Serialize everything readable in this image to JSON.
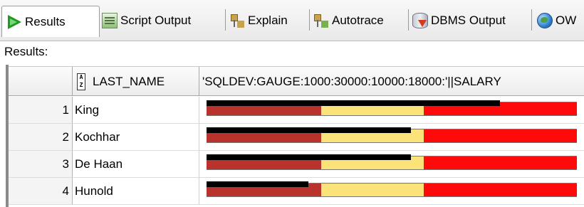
{
  "tabs": [
    {
      "label": "Results",
      "icon": "play-icon"
    },
    {
      "label": "Script Output",
      "icon": "script-output-icon"
    },
    {
      "label": "Explain",
      "icon": "explain-icon"
    },
    {
      "label": "Autotrace",
      "icon": "autotrace-icon"
    },
    {
      "label": "DBMS Output",
      "icon": "dbms-output-icon"
    },
    {
      "label": "OW",
      "icon": "globe-icon"
    }
  ],
  "results_label": "Results:",
  "columns": {
    "last_name": "LAST_NAME",
    "gauge": "'SQLDEV:GAUGE:1000:30000:10000:18000:'||SALARY"
  },
  "gauge_spec": {
    "min": 1000,
    "max": 30000,
    "low": 10000,
    "high": 18000
  },
  "rows": [
    {
      "num": "1",
      "last_name": "King",
      "salary": 24000
    },
    {
      "num": "2",
      "last_name": "Kochhar",
      "salary": 17000
    },
    {
      "num": "3",
      "last_name": "De Haan",
      "salary": 17000
    },
    {
      "num": "4",
      "last_name": "Hunold",
      "salary": 9000
    }
  ],
  "colors": {
    "low_band": "#b9322c",
    "mid_band": "#fbe37a",
    "high_band": "#ff0a0a",
    "value_bar": "#000000"
  }
}
